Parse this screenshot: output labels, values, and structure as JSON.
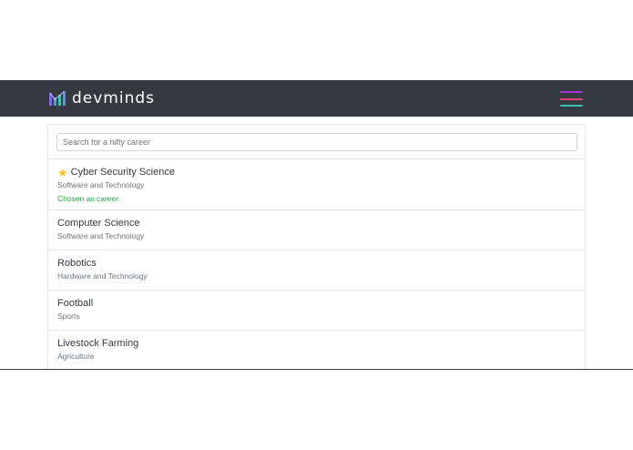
{
  "brand": {
    "name": "devminds",
    "logo_icon": "bar-chart-icon"
  },
  "menu": {
    "icon": "hamburger-menu-icon",
    "colors": [
      "#a832d8",
      "#e0407a",
      "#3ac0b0"
    ]
  },
  "search": {
    "placeholder": "Search for a nifty career",
    "value": ""
  },
  "careers": [
    {
      "title": "Cyber Security Science",
      "category": "Software and Technology",
      "starred": true,
      "status": "Chosen as career"
    },
    {
      "title": "Computer Science",
      "category": "Software and Technology"
    },
    {
      "title": "Robotics",
      "category": "Hardware and Technology"
    },
    {
      "title": "Football",
      "category": "Sports"
    },
    {
      "title": "Livestock Farming",
      "category": "Agriculture"
    }
  ],
  "colors": {
    "navbar": "#343a40",
    "chosen": "#28a745",
    "star": "#f5c518"
  }
}
